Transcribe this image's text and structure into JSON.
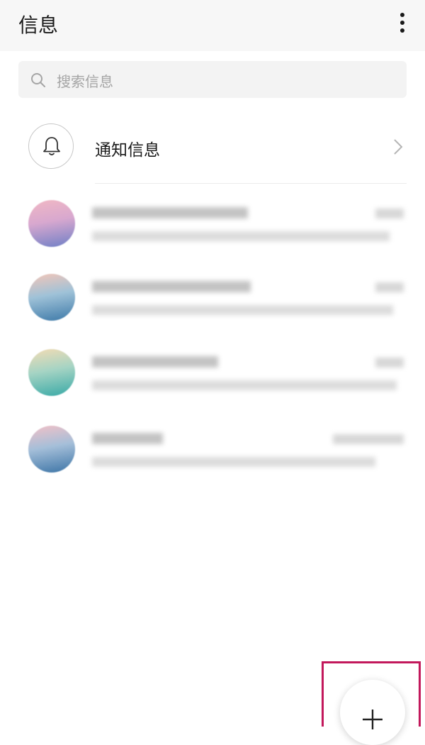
{
  "header": {
    "title": "信息"
  },
  "search": {
    "placeholder": "搜索信息"
  },
  "notification": {
    "label": "通知信息"
  },
  "conversations": [
    {
      "avatar_colors": [
        "#f1b8c4",
        "#6f7fc6"
      ]
    },
    {
      "avatar_colors": [
        "#f4c6b8",
        "#3d79a8"
      ]
    },
    {
      "avatar_colors": [
        "#f3dcb4",
        "#38a9a6"
      ]
    },
    {
      "avatar_colors": [
        "#f2c1c7",
        "#3c74a6"
      ]
    }
  ],
  "fab": {
    "icon": "plus-icon"
  },
  "colors": {
    "highlight": "#c2185b"
  }
}
